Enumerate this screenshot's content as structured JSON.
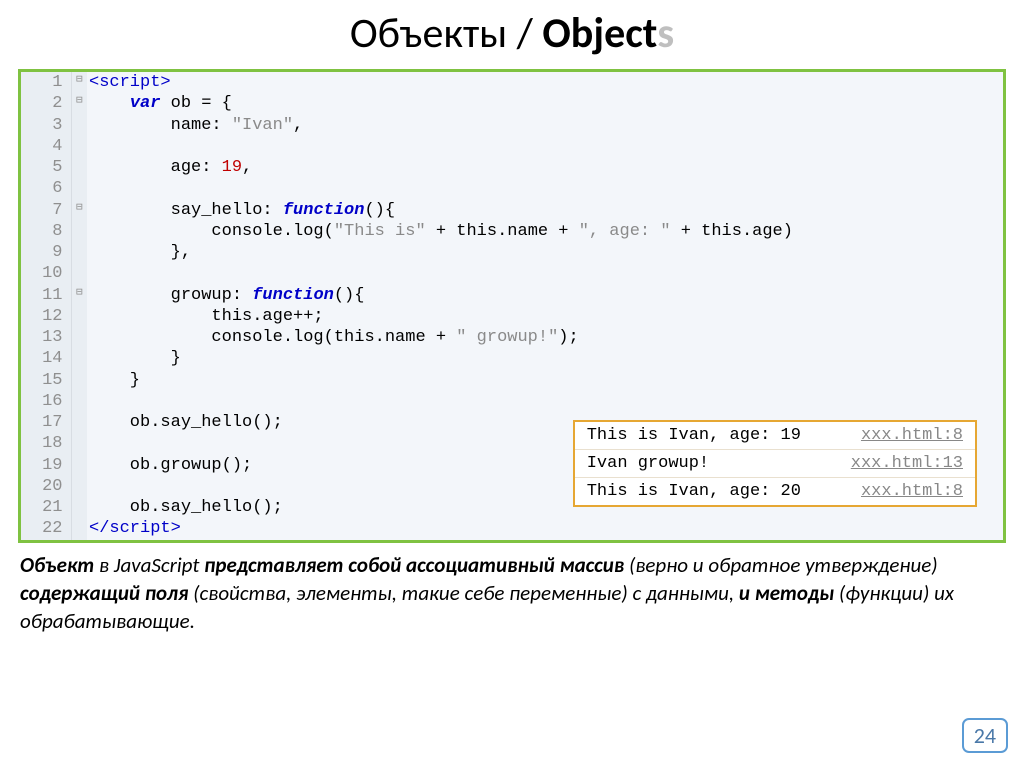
{
  "title": {
    "ru": "Объекты",
    "sep": " / ",
    "en1": "Object",
    "en2": "s"
  },
  "code": [
    {
      "n": "1",
      "fold": "⊟",
      "frag": [
        {
          "c": "tag",
          "t": "<script>"
        }
      ]
    },
    {
      "n": "2",
      "fold": "⊟",
      "frag": [
        {
          "c": "",
          "t": "    "
        },
        {
          "c": "kw",
          "t": "var"
        },
        {
          "c": "",
          "t": " ob = {"
        }
      ]
    },
    {
      "n": "3",
      "fold": "",
      "frag": [
        {
          "c": "",
          "t": "        name: "
        },
        {
          "c": "str",
          "t": "\"Ivan\""
        },
        {
          "c": "",
          "t": ","
        }
      ]
    },
    {
      "n": "4",
      "fold": "",
      "frag": [
        {
          "c": "",
          "t": ""
        }
      ]
    },
    {
      "n": "5",
      "fold": "",
      "frag": [
        {
          "c": "",
          "t": "        age: "
        },
        {
          "c": "num",
          "t": "19"
        },
        {
          "c": "",
          "t": ","
        }
      ]
    },
    {
      "n": "6",
      "fold": "",
      "frag": [
        {
          "c": "",
          "t": ""
        }
      ]
    },
    {
      "n": "7",
      "fold": "⊟",
      "frag": [
        {
          "c": "",
          "t": "        say_hello: "
        },
        {
          "c": "fn",
          "t": "function"
        },
        {
          "c": "",
          "t": "(){"
        }
      ]
    },
    {
      "n": "8",
      "fold": "",
      "frag": [
        {
          "c": "",
          "t": "            console.log("
        },
        {
          "c": "str",
          "t": "\"This is\""
        },
        {
          "c": "",
          "t": " + this.name + "
        },
        {
          "c": "str",
          "t": "\", age: \""
        },
        {
          "c": "",
          "t": " + this.age)"
        }
      ]
    },
    {
      "n": "9",
      "fold": "",
      "frag": [
        {
          "c": "",
          "t": "        },"
        }
      ]
    },
    {
      "n": "10",
      "fold": "",
      "frag": [
        {
          "c": "",
          "t": ""
        }
      ]
    },
    {
      "n": "11",
      "fold": "⊟",
      "frag": [
        {
          "c": "",
          "t": "        growup: "
        },
        {
          "c": "fn",
          "t": "function"
        },
        {
          "c": "",
          "t": "(){"
        }
      ]
    },
    {
      "n": "12",
      "fold": "",
      "frag": [
        {
          "c": "",
          "t": "            this.age++;"
        }
      ]
    },
    {
      "n": "13",
      "fold": "",
      "frag": [
        {
          "c": "",
          "t": "            console.log(this.name + "
        },
        {
          "c": "str",
          "t": "\" growup!\""
        },
        {
          "c": "",
          "t": ");"
        }
      ]
    },
    {
      "n": "14",
      "fold": "",
      "frag": [
        {
          "c": "",
          "t": "        }"
        }
      ]
    },
    {
      "n": "15",
      "fold": "",
      "frag": [
        {
          "c": "",
          "t": "    }"
        }
      ]
    },
    {
      "n": "16",
      "fold": "",
      "frag": [
        {
          "c": "",
          "t": ""
        }
      ]
    },
    {
      "n": "17",
      "fold": "",
      "frag": [
        {
          "c": "",
          "t": "    ob.say_hello();"
        }
      ]
    },
    {
      "n": "18",
      "fold": "",
      "frag": [
        {
          "c": "",
          "t": ""
        }
      ]
    },
    {
      "n": "19",
      "fold": "",
      "frag": [
        {
          "c": "",
          "t": "    ob.growup();"
        }
      ]
    },
    {
      "n": "20",
      "fold": "",
      "frag": [
        {
          "c": "",
          "t": ""
        }
      ]
    },
    {
      "n": "21",
      "fold": "",
      "frag": [
        {
          "c": "",
          "t": "    ob.say_hello();"
        }
      ]
    },
    {
      "n": "22",
      "fold": "",
      "frag": [
        {
          "c": "tag",
          "t": "</script"
        },
        {
          "c": "tag",
          "t": ">"
        }
      ]
    }
  ],
  "console": [
    {
      "text": "This is Ivan, age: 19",
      "loc": "xxx.html:8"
    },
    {
      "text": "Ivan growup!",
      "loc": "xxx.html:13"
    },
    {
      "text": "This is Ivan, age: 20",
      "loc": "xxx.html:8"
    }
  ],
  "notes": {
    "p1a": "Объект",
    "p1b": " в JavaScript ",
    "p1c": "представляет собой ассоциативный массив",
    "p2a": "(верно и обратное утверждение) ",
    "p2b": "содержащий поля",
    "p2c": " (свойства, элементы, такие себе переменные) с данными, ",
    "p2d": "и методы",
    "p2e": " (функции) их обрабатывающие."
  },
  "page_number": "24"
}
